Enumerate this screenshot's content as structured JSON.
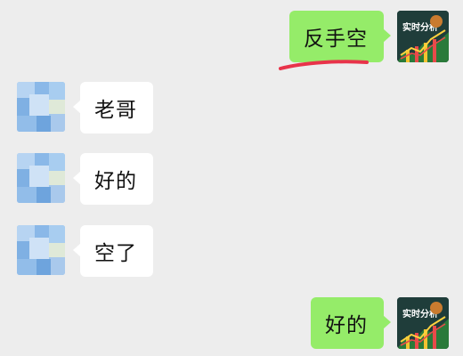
{
  "messages": [
    {
      "direction": "out",
      "text": "反手空"
    },
    {
      "direction": "in",
      "text": "老哥"
    },
    {
      "direction": "in",
      "text": "好的"
    },
    {
      "direction": "in",
      "text": "空了"
    },
    {
      "direction": "out",
      "text": "好的"
    }
  ],
  "avatar_out": {
    "icon": "stock-chart-app-icon",
    "label": "实时分析"
  },
  "avatar_in": {
    "icon": "pixelated-user-avatar"
  },
  "colors": {
    "background": "#ededed",
    "outgoing_bubble": "#95ec69",
    "incoming_bubble": "#ffffff",
    "annotation": "#e8334a"
  }
}
